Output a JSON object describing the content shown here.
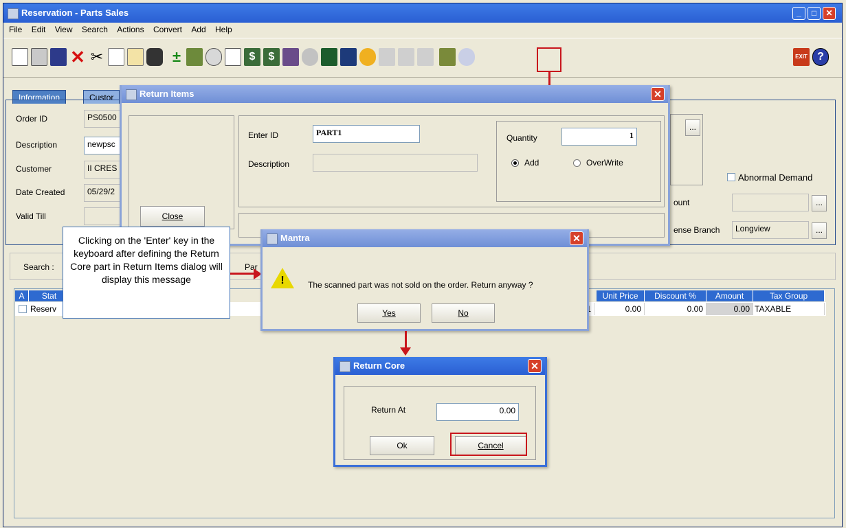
{
  "window": {
    "title": "Reservation - Parts Sales",
    "min": "_",
    "max": "□",
    "close": "✕"
  },
  "menu": [
    "File",
    "Edit",
    "View",
    "Search",
    "Actions",
    "Convert",
    "Add",
    "Help"
  ],
  "toolbar": {
    "icons": [
      "new-icon",
      "print-icon",
      "save-icon",
      "delete-icon",
      "cut-icon",
      "copy-icon",
      "paste-icon",
      "binoculars-icon",
      "plus-minus-icon",
      "parts-icon",
      "group-icon",
      "note-icon",
      "pay-icon",
      "bill-icon",
      "ship-icon",
      "gear-icon",
      "invoice-icon",
      "calc-icon",
      "worker-icon",
      "disabled-icon",
      "disabled-icon",
      "return-items-icon",
      "settings-icon"
    ],
    "exit_label": "EXIT",
    "help_label": "?"
  },
  "tabs": {
    "information": "Information",
    "customer": "Custor"
  },
  "info": {
    "order_id_label": "Order ID",
    "order_id": "PS0500",
    "description_label": "Description",
    "description": "newpsc",
    "customer_label": "Customer",
    "customer": "II CRES",
    "date_created_label": "Date Created",
    "date_created": "05/29/2",
    "valid_till_label": "Valid Till",
    "valid_till": ""
  },
  "right_panel": {
    "abnormal_demand": "Abnormal Demand",
    "account_label": "ount",
    "branch_label": "ense Branch",
    "branch_value": "Longview",
    "ellipsis": "..."
  },
  "search_row": {
    "search_label": "Search :",
    "par_label": "Par"
  },
  "grid": {
    "headers_left": [
      "A",
      "Stat"
    ],
    "headers_right": [
      "Unit Price",
      "Discount %",
      "Amount",
      "Tax Group"
    ],
    "row": {
      "status": "Reserv",
      "qty": "1",
      "unit_price": "0.00",
      "discount": "0.00",
      "amount": "0.00",
      "tax_group": "TAXABLE"
    }
  },
  "return_items": {
    "title": "Return Items",
    "close_label": "Close",
    "enter_id_label": "Enter ID",
    "enter_id_value": "PART1",
    "description_label": "Description",
    "description_value": "",
    "quantity_label": "Quantity",
    "quantity_value": "1",
    "add_label": "Add",
    "overwrite_label": "OverWrite"
  },
  "mantra": {
    "title": "Mantra",
    "message": "The scanned part was not sold on the order. Return anyway ?",
    "yes_label": "Yes",
    "no_label": "No"
  },
  "return_core": {
    "title": "Return Core",
    "return_at_label": "Return At",
    "return_at_value": "0.00",
    "ok_label": "Ok",
    "cancel_label": "Cancel"
  },
  "callout": {
    "text": "Clicking on the 'Enter' key in the keyboard after defining the Return Core part  in Return Items dialog will display this message"
  },
  "colors": {
    "annotation_red": "#c8151c",
    "title_blue": "#2a5fd3",
    "grid_header": "#2e6ad0"
  }
}
